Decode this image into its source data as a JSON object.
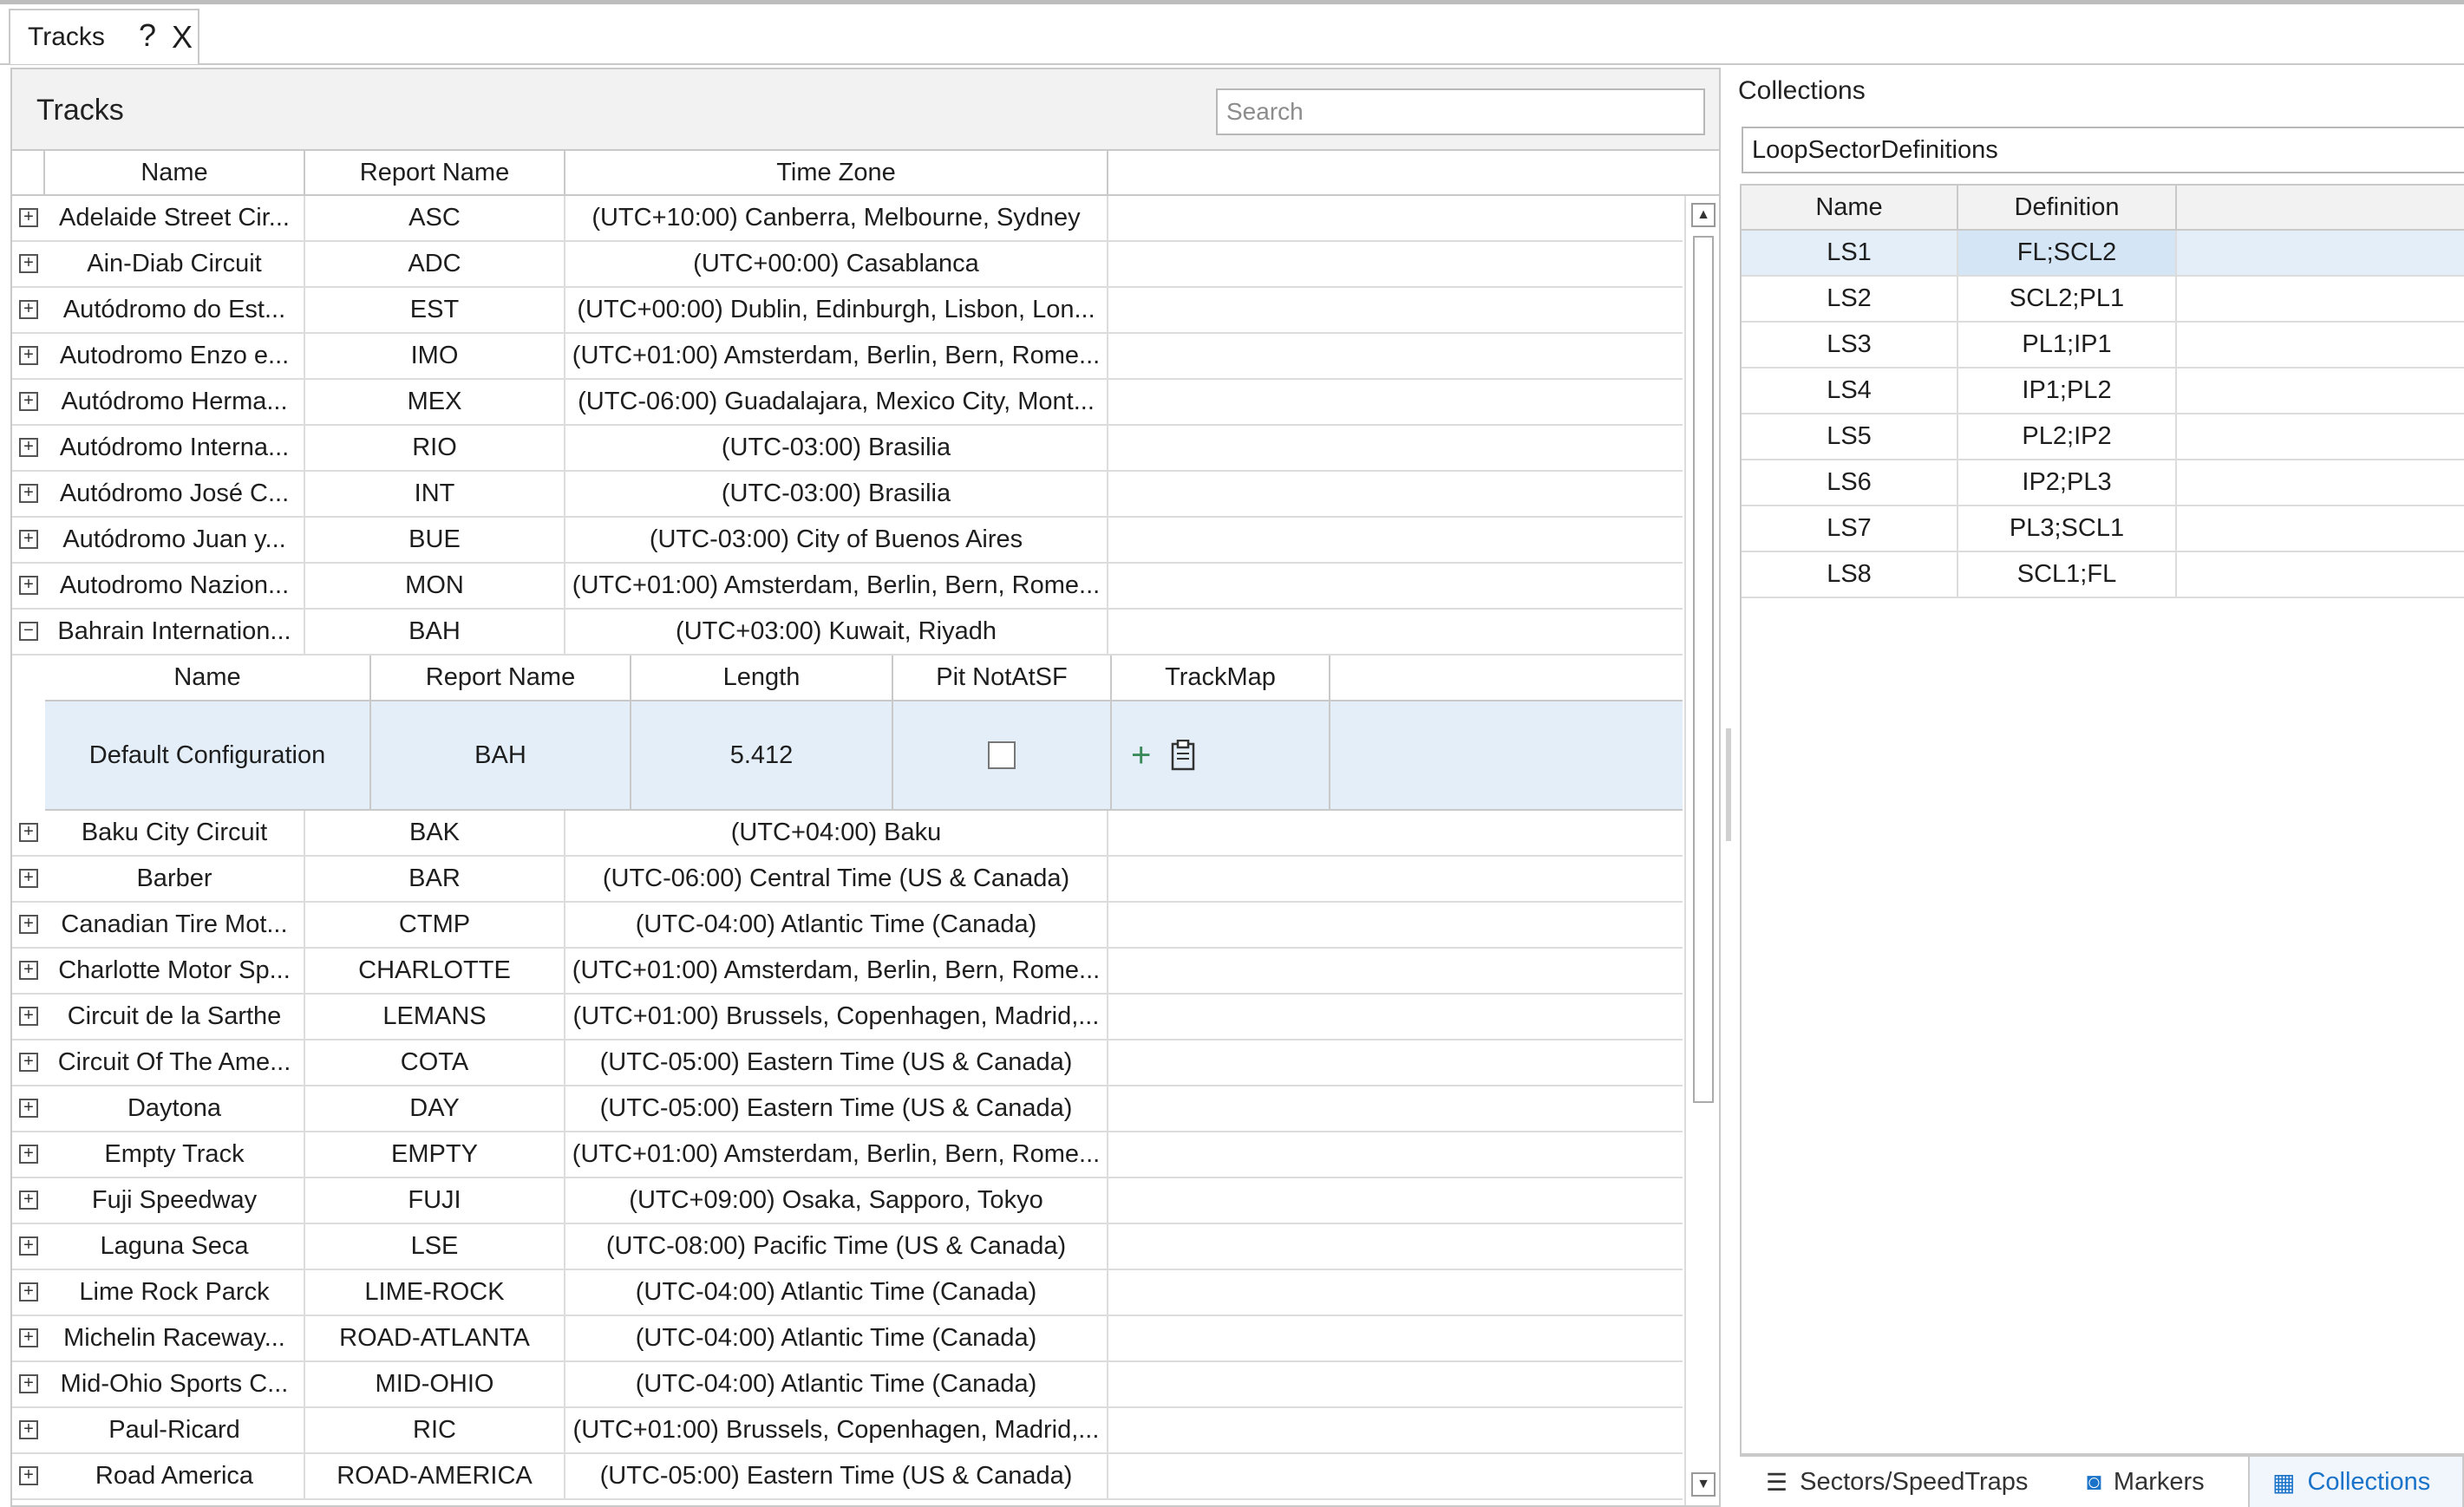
{
  "window": {
    "tab_label": "Tracks",
    "help_icon": "?",
    "close_icon": "X"
  },
  "tracks_panel": {
    "title": "Tracks",
    "search_placeholder": "Search",
    "columns": [
      "Name",
      "Report Name",
      "Time Zone"
    ],
    "rows": [
      {
        "name": "Adelaide Street Cir...",
        "report": "ASC",
        "tz": "(UTC+10:00) Canberra, Melbourne, Sydney",
        "expanded": false
      },
      {
        "name": "Ain-Diab Circuit",
        "report": "ADC",
        "tz": "(UTC+00:00) Casablanca",
        "expanded": false
      },
      {
        "name": "Autódromo do Est...",
        "report": "EST",
        "tz": "(UTC+00:00) Dublin, Edinburgh, Lisbon, Lon...",
        "expanded": false
      },
      {
        "name": "Autodromo Enzo e...",
        "report": "IMO",
        "tz": "(UTC+01:00) Amsterdam, Berlin, Bern, Rome...",
        "expanded": false
      },
      {
        "name": "Autódromo Herma...",
        "report": "MEX",
        "tz": "(UTC-06:00) Guadalajara, Mexico City, Mont...",
        "expanded": false
      },
      {
        "name": "Autódromo Interna...",
        "report": "RIO",
        "tz": "(UTC-03:00) Brasilia",
        "expanded": false
      },
      {
        "name": "Autódromo José C...",
        "report": "INT",
        "tz": "(UTC-03:00) Brasilia",
        "expanded": false
      },
      {
        "name": "Autódromo Juan y...",
        "report": "BUE",
        "tz": "(UTC-03:00) City of Buenos Aires",
        "expanded": false
      },
      {
        "name": "Autodromo Nazion...",
        "report": "MON",
        "tz": "(UTC+01:00) Amsterdam, Berlin, Bern, Rome...",
        "expanded": false
      },
      {
        "name": "Bahrain Internation...",
        "report": "BAH",
        "tz": "(UTC+03:00) Kuwait, Riyadh",
        "expanded": true
      },
      {
        "name": "Baku City Circuit",
        "report": "BAK",
        "tz": "(UTC+04:00) Baku",
        "expanded": false
      },
      {
        "name": "Barber",
        "report": "BAR",
        "tz": "(UTC-06:00) Central Time (US & Canada)",
        "expanded": false
      },
      {
        "name": "Canadian Tire Mot...",
        "report": "CTMP",
        "tz": "(UTC-04:00) Atlantic Time (Canada)",
        "expanded": false
      },
      {
        "name": "Charlotte Motor Sp...",
        "report": "CHARLOTTE",
        "tz": "(UTC+01:00) Amsterdam, Berlin, Bern, Rome...",
        "expanded": false
      },
      {
        "name": "Circuit de la Sarthe",
        "report": "LEMANS",
        "tz": "(UTC+01:00) Brussels, Copenhagen, Madrid,...",
        "expanded": false
      },
      {
        "name": "Circuit Of The Ame...",
        "report": "COTA",
        "tz": "(UTC-05:00) Eastern Time (US & Canada)",
        "expanded": false
      },
      {
        "name": "Daytona",
        "report": "DAY",
        "tz": "(UTC-05:00) Eastern Time (US & Canada)",
        "expanded": false
      },
      {
        "name": "Empty Track",
        "report": "EMPTY",
        "tz": "(UTC+01:00) Amsterdam, Berlin, Bern, Rome...",
        "expanded": false
      },
      {
        "name": "Fuji Speedway",
        "report": "FUJI",
        "tz": "(UTC+09:00) Osaka, Sapporo, Tokyo",
        "expanded": false
      },
      {
        "name": "Laguna Seca",
        "report": "LSE",
        "tz": "(UTC-08:00) Pacific Time (US & Canada)",
        "expanded": false
      },
      {
        "name": "Lime Rock Parck",
        "report": "LIME-ROCK",
        "tz": "(UTC-04:00) Atlantic Time (Canada)",
        "expanded": false
      },
      {
        "name": "Michelin Raceway...",
        "report": "ROAD-ATLANTA",
        "tz": "(UTC-04:00) Atlantic Time (Canada)",
        "expanded": false
      },
      {
        "name": "Mid-Ohio Sports C...",
        "report": "MID-OHIO",
        "tz": "(UTC-04:00) Atlantic Time (Canada)",
        "expanded": false
      },
      {
        "name": "Paul-Ricard",
        "report": "RIC",
        "tz": "(UTC+01:00) Brussels, Copenhagen, Madrid,...",
        "expanded": false
      },
      {
        "name": "Road America",
        "report": "ROAD-AMERICA",
        "tz": "(UTC-05:00) Eastern Time (US & Canada)",
        "expanded": false
      }
    ],
    "config_table": {
      "columns": [
        "Name",
        "Report Name",
        "Length",
        "Pit NotAtSF",
        "TrackMap"
      ],
      "row": {
        "name": "Default Configuration",
        "report": "BAH",
        "length": "5.412",
        "pit_not_at_sf": false
      }
    }
  },
  "collections_panel": {
    "title": "Collections",
    "selected_collection": "LoopSectorDefinitions",
    "columns": [
      "Name",
      "Definition"
    ],
    "rows": [
      {
        "name": "LS1",
        "definition": "FL;SCL2"
      },
      {
        "name": "LS2",
        "definition": "SCL2;PL1"
      },
      {
        "name": "LS3",
        "definition": "PL1;IP1"
      },
      {
        "name": "LS4",
        "definition": "IP1;PL2"
      },
      {
        "name": "LS5",
        "definition": "PL2;IP2"
      },
      {
        "name": "LS6",
        "definition": "IP2;PL3"
      },
      {
        "name": "LS7",
        "definition": "PL3;SCL1"
      },
      {
        "name": "LS8",
        "definition": "SCL1;FL"
      }
    ],
    "bottom_tabs": [
      {
        "label": "Sectors/SpeedTraps",
        "icon": "list-icon"
      },
      {
        "label": "Markers",
        "icon": "marker-icon"
      },
      {
        "label": "Collections",
        "icon": "grid-icon",
        "active": true
      }
    ]
  },
  "colors": {
    "selection": "#e3eef8",
    "active_tab_text": "#1a73c8",
    "border": "#c9c9c9"
  }
}
